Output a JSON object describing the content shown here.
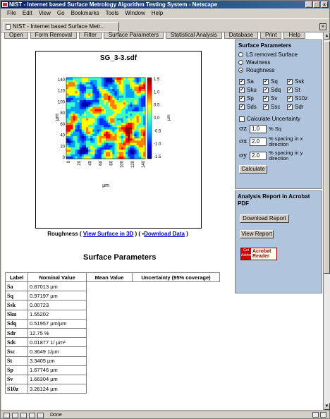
{
  "window": {
    "title": "NIST - Internet based Surface Metrology Algorithm Testing System - Netscape"
  },
  "menu": [
    "File",
    "Edit",
    "View",
    "Go",
    "Bookmarks",
    "Tools",
    "Window",
    "Help"
  ],
  "browser_tab": {
    "label": "NIST - Internet based Surface Metr..."
  },
  "nav_tabs": [
    "Open",
    "Form Removal",
    "Filter",
    "Surface Parameters",
    "Statistical Analysis",
    "Database",
    "Print",
    "Help"
  ],
  "plot": {
    "title": "SG_3-3.sdf",
    "xlabel": "µm",
    "ylabel": "µm",
    "colorbar_unit": "µm",
    "xticks": [
      "0",
      "20",
      "40",
      "60",
      "80",
      "100",
      "120",
      "140"
    ],
    "yticks": [
      "140",
      "120",
      "100",
      "80",
      "60",
      "40",
      "20",
      "0"
    ],
    "cbticks": [
      "1.5",
      "1.0",
      "0.5",
      "0.0",
      "-0.5",
      "-1.0",
      "-1.5"
    ]
  },
  "caption": {
    "prefix": "Roughness ( ",
    "link3d": "View Surface in 3D",
    "mid": " ) ( ",
    "download": "Download Data",
    "suffix": " )"
  },
  "side_panel": {
    "title": "Surface Parameters",
    "options": [
      {
        "label": "LS removed Surface",
        "selected": false
      },
      {
        "label": "Waviness",
        "selected": false
      },
      {
        "label": "Roughness",
        "selected": true
      }
    ],
    "checkboxes": [
      "Sa",
      "Sq",
      "Ssk",
      "Sku",
      "Sdq",
      "St",
      "Sp",
      "Sv",
      "S10z",
      "Sds",
      "Ssc",
      "Sdr"
    ],
    "uncertainty_label": "Calculate Uncertainty",
    "sigma_z": {
      "symbol": "σz",
      "value": "1.0",
      "label": "% Sq"
    },
    "sigma_x": {
      "symbol": "σx",
      "value": "2.0",
      "label": "% spacing in x direction"
    },
    "sigma_y": {
      "symbol": "σy",
      "value": "2.0",
      "label": "% spacing in y direction"
    },
    "calculate_label": "Calculate"
  },
  "report": {
    "title": "Analysis Report in Acrobat PDF",
    "download_label": "Download Report",
    "view_label": "View Report",
    "acrobat_get": "Get",
    "acrobat_name": "Acrobat Reader",
    "adobe": "Adobe"
  },
  "params": {
    "title": "Surface Parameters",
    "headers": [
      "Label",
      "Nominal Value",
      "Mean Value",
      "Uncertainty (95% coverage)"
    ],
    "rows": [
      {
        "label": "Sa",
        "value": "0.87013 µm"
      },
      {
        "label": "Sq",
        "value": "0.97197 µm"
      },
      {
        "label": "Ssk",
        "value": "0.00723"
      },
      {
        "label": "Sku",
        "value": "1.55202"
      },
      {
        "label": "Sdq",
        "value": "0.51957 µm/µm"
      },
      {
        "label": "Sdr",
        "value": "12.75 %"
      },
      {
        "label": "Sds",
        "value": "0.01877 1/ µm²"
      },
      {
        "label": "Ssc",
        "value": "0.3649 1/µm"
      },
      {
        "label": "St",
        "value": "3.3405 µm"
      },
      {
        "label": "Sp",
        "value": "1.67746 µm"
      },
      {
        "label": "Sv",
        "value": "1.66304 µm"
      },
      {
        "label": "S10z",
        "value": "3.26124 µm"
      }
    ]
  },
  "status": {
    "text": "Done"
  },
  "colors": {
    "panel": "#b0c4de",
    "title_start": "#0a246a",
    "link": "#0000cc"
  }
}
